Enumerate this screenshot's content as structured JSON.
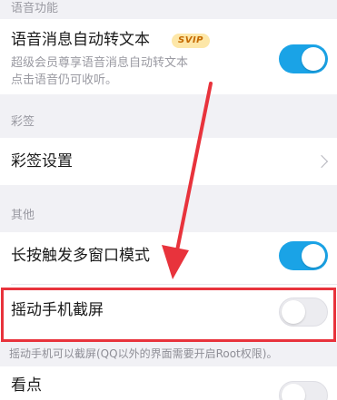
{
  "sections": {
    "voice": {
      "header": "语音功能"
    },
    "sign": {
      "header": "彩签"
    },
    "other": {
      "header": "其他"
    }
  },
  "voice_to_text": {
    "title": "语音消息自动转文本",
    "badge": "SVIP",
    "subtitle_line1": "超级会员尊享语音消息自动转文本",
    "subtitle_line2": "点击语音仍可收听。",
    "toggle_on": true
  },
  "sign_settings": {
    "title": "彩签设置"
  },
  "long_press_multiwindow": {
    "title": "长按触发多窗口模式",
    "toggle_on": true
  },
  "shake_screenshot": {
    "title": "摇动手机截屏",
    "toggle_on": false,
    "note": "摇动手机可以截屏(QQ以外的界面需要开启Root权限)。"
  },
  "kandian": {
    "title": "看点",
    "toggle_on": false
  },
  "colors": {
    "toggle_on": "#1aa3e6",
    "annotation": "#e8333c"
  }
}
